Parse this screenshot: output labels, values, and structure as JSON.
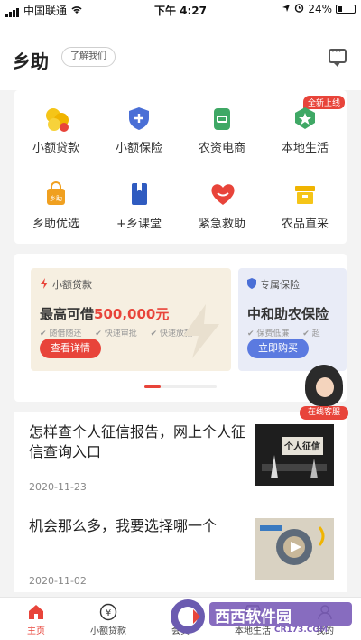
{
  "status": {
    "carrier": "中国联通",
    "time": "下午 4:27",
    "battery": "24%"
  },
  "header": {
    "title": "乡助",
    "about": "了解我们"
  },
  "services": {
    "new_tag": "全新上线",
    "items": [
      {
        "label": "小额贷款",
        "icon": "coins-icon"
      },
      {
        "label": "小额保险",
        "icon": "shield-plus-icon"
      },
      {
        "label": "农资电商",
        "icon": "seed-bag-icon"
      },
      {
        "label": "本地生活",
        "icon": "star-badge-icon"
      },
      {
        "label": "乡助优选",
        "icon": "shopping-bag-icon"
      },
      {
        "label": "+乡课堂",
        "icon": "book-icon"
      },
      {
        "label": "紧急救助",
        "icon": "heart-icon"
      },
      {
        "label": "农品直采",
        "icon": "box-icon"
      }
    ]
  },
  "banners": [
    {
      "tag": "小额贷款",
      "head_pre": "最高可借",
      "amount": "500,000元",
      "features": [
        "随借随还",
        "快速审批",
        "快速放款"
      ],
      "cta": "查看详情"
    },
    {
      "tag": "专属保险",
      "head_pre": "中和助农保险",
      "amount": "",
      "features": [
        "保费低廉",
        "超"
      ],
      "cta": "立即购买"
    }
  ],
  "customer_service": {
    "label": "在线客服"
  },
  "news": [
    {
      "title": "怎样查个人征信报告，网上个人征信查询入口",
      "date": "2020-11-23",
      "thumb_text": "个人征信"
    },
    {
      "title": "机会那么多，我要选择哪一个",
      "date": "2020-11-02"
    }
  ],
  "tabbar": {
    "tabs": [
      {
        "label": "主页",
        "active": true
      },
      {
        "label": "小额贷款",
        "active": false
      },
      {
        "label": "会员",
        "active": false
      },
      {
        "label": "本地生活",
        "active": false
      },
      {
        "label": "我的",
        "active": false
      }
    ]
  },
  "watermark": {
    "brand": "西西软件园",
    "domain": "CR173.COM"
  },
  "colors": {
    "accent": "#e8443a",
    "blue": "#4a6fd6",
    "green": "#3fa865"
  }
}
